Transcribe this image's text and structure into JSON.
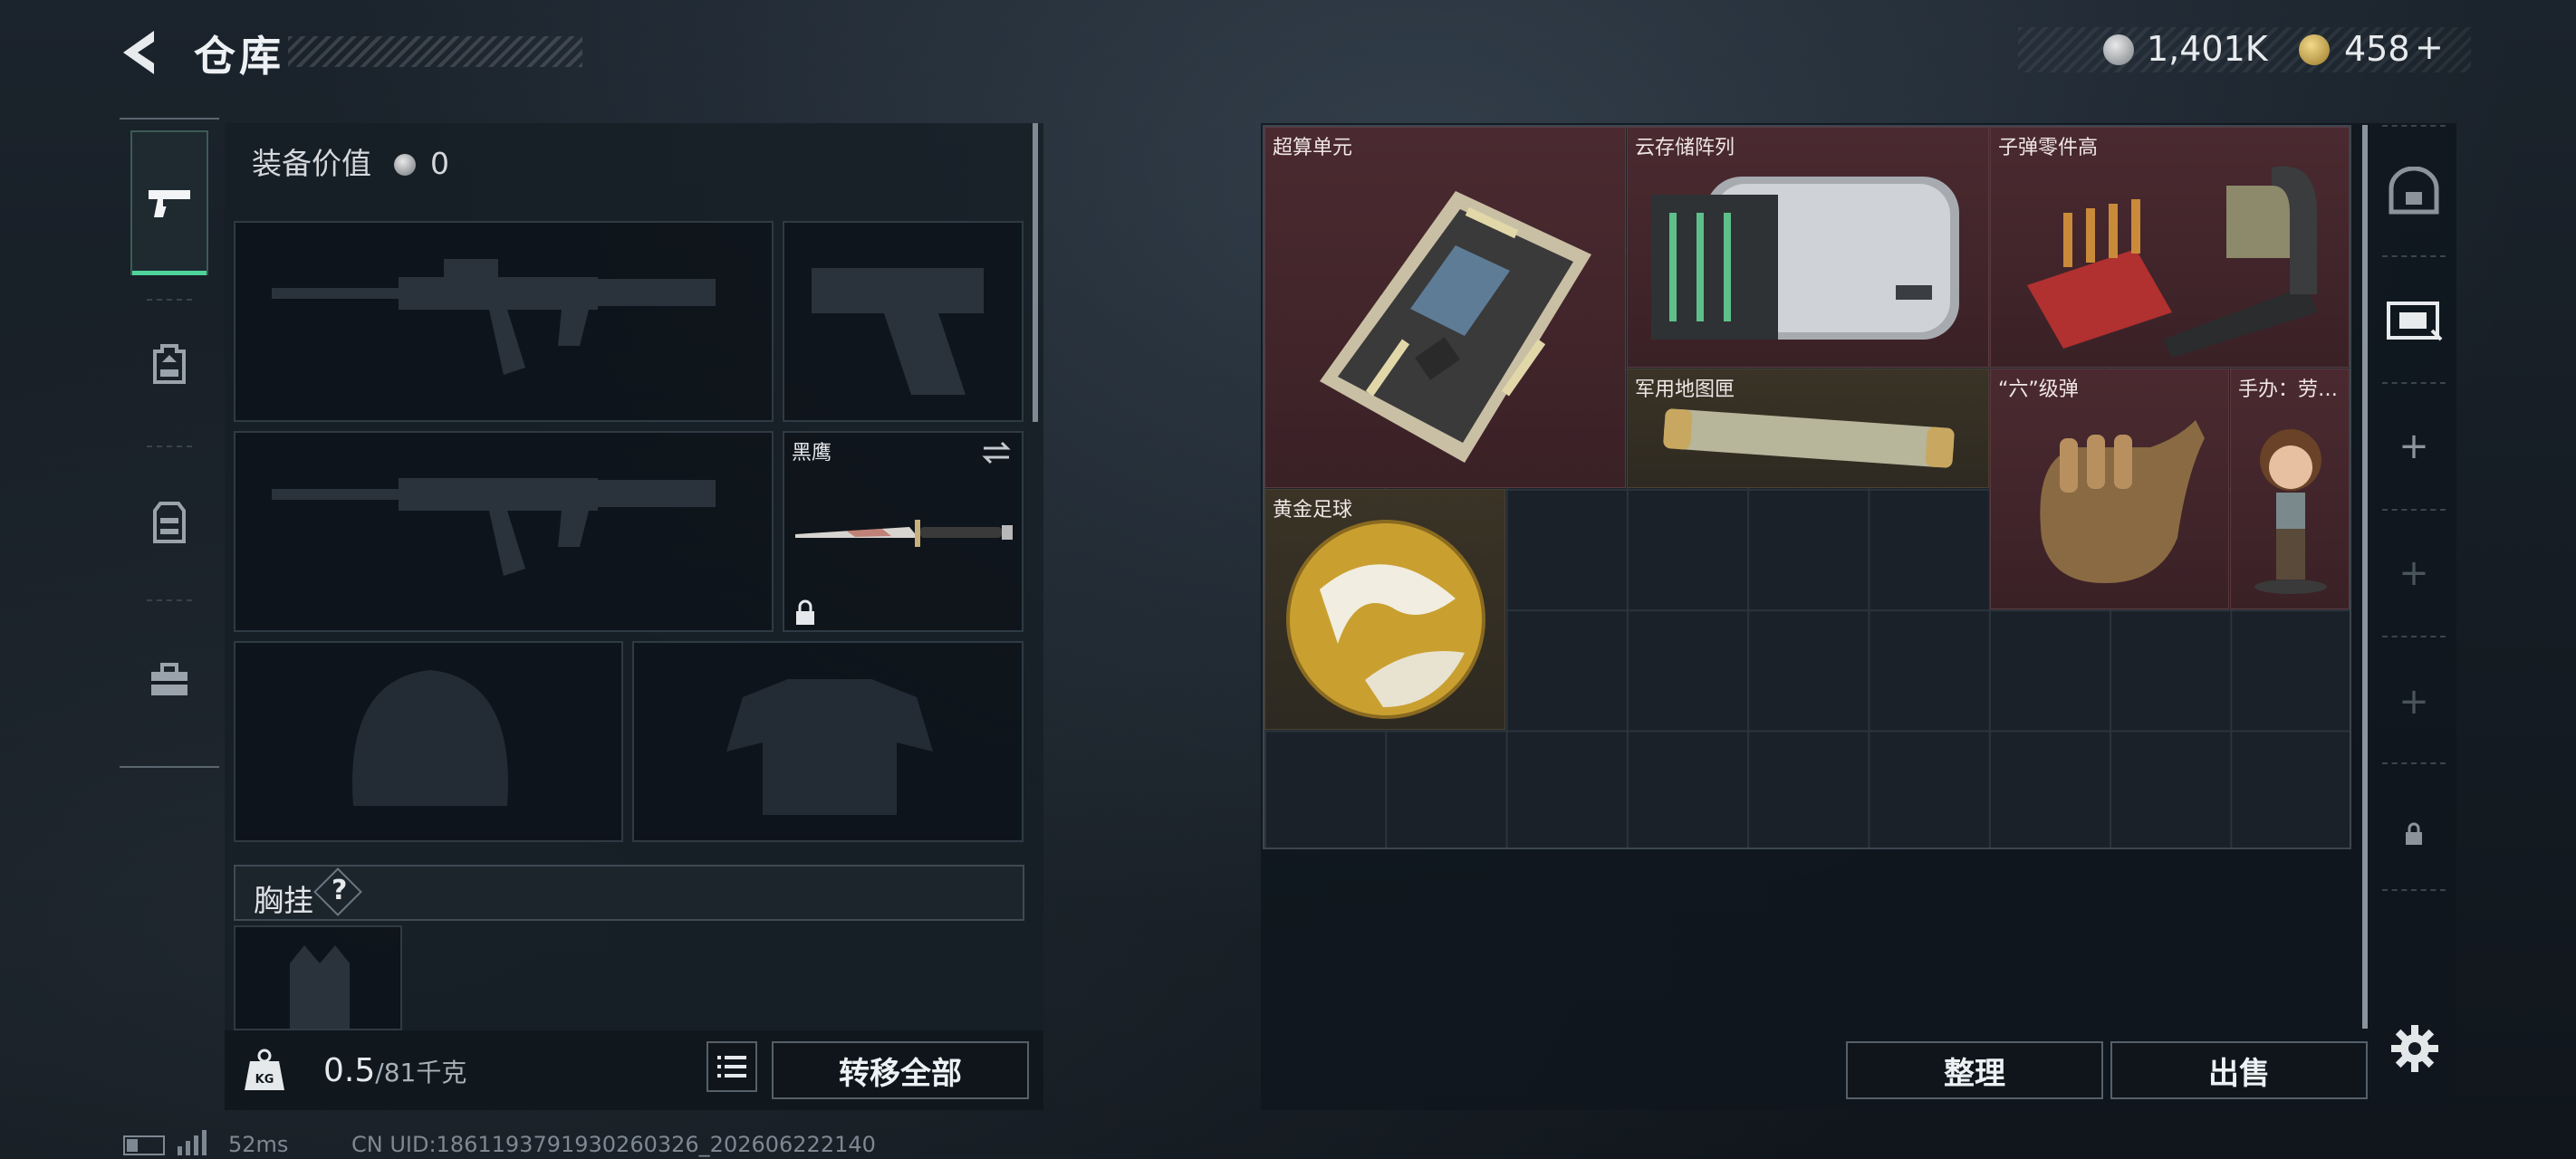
{
  "header": {
    "title": "仓库",
    "currency1": "1,401K",
    "currency2": "458",
    "currency2_add": "+"
  },
  "equipment": {
    "value_label": "装备价值",
    "value": "0",
    "melee_name": "黑鹰",
    "chest_label": "胸挂",
    "chest_help": "?"
  },
  "footer": {
    "weight_current": "0.5",
    "weight_max": "/81千克",
    "transfer_all": "转移全部",
    "sort": "整理",
    "sell": "出售"
  },
  "storage": {
    "items": [
      {
        "name": "超算单元",
        "rarity": "red"
      },
      {
        "name": "云存储阵列",
        "rarity": "red"
      },
      {
        "name": "子弹零件高",
        "rarity": "red"
      },
      {
        "name": "军用地图匣",
        "rarity": "brown"
      },
      {
        "name": "“六”级弹",
        "rarity": "red"
      },
      {
        "name": "手办：劳…",
        "rarity": "red"
      },
      {
        "name": "黄金足球",
        "rarity": "brown"
      }
    ]
  },
  "status": {
    "ping": "52ms",
    "uid": "CN UID:1861193791930260326_202606222140"
  },
  "icons": {
    "back": "back-arrow-icon",
    "tab1": "pistol-icon",
    "tab2": "backpack-icon",
    "tab3": "vest-icon",
    "tab4": "toolbox-icon",
    "weight": "weight-icon",
    "list": "list-icon",
    "settings": "gear-icon"
  },
  "colors": {
    "accent_green": "#4ed49a",
    "red_rarity": "#4a2a30",
    "gold_rarity": "#3a3326"
  }
}
